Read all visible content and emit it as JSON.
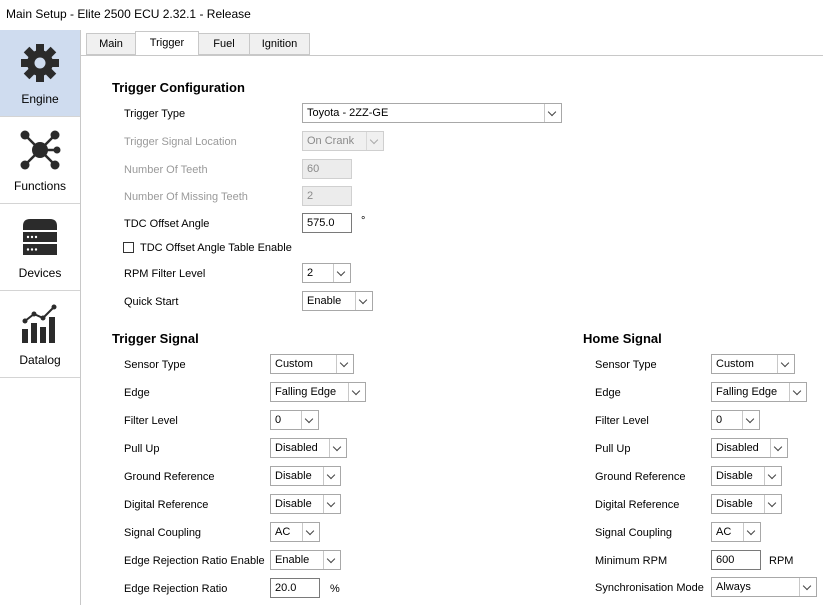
{
  "window": {
    "title": "Main Setup - Elite 2500 ECU 2.32.1 - Release"
  },
  "sidebar": {
    "items": [
      {
        "label": "Engine",
        "icon": "gear-icon",
        "active": true
      },
      {
        "label": "Functions",
        "icon": "network-icon"
      },
      {
        "label": "Devices",
        "icon": "server-icon"
      },
      {
        "label": "Datalog",
        "icon": "chart-icon"
      }
    ]
  },
  "tabs": [
    "Main",
    "Trigger",
    "Fuel",
    "Ignition"
  ],
  "trigger_config": {
    "heading": "Trigger Configuration",
    "trigger_type": {
      "label": "Trigger Type",
      "value": "Toyota - 2ZZ-GE"
    },
    "signal_location": {
      "label": "Trigger Signal Location",
      "value": "On Crank"
    },
    "num_teeth": {
      "label": "Number Of Teeth",
      "value": "60"
    },
    "missing_teeth": {
      "label": "Number Of Missing Teeth",
      "value": "2"
    },
    "tdc_offset": {
      "label": "TDC Offset Angle",
      "value": "575.0",
      "unit": "°"
    },
    "tdc_table_enable": {
      "label": "TDC Offset Angle Table Enable",
      "checked": false
    },
    "rpm_filter": {
      "label": "RPM Filter Level",
      "value": "2"
    },
    "quick_start": {
      "label": "Quick Start",
      "value": "Enable"
    }
  },
  "trigger_signal": {
    "heading": "Trigger Signal",
    "sensor_type": {
      "label": "Sensor Type",
      "value": "Custom"
    },
    "edge": {
      "label": "Edge",
      "value": "Falling Edge"
    },
    "filter_level": {
      "label": "Filter Level",
      "value": "0"
    },
    "pull_up": {
      "label": "Pull Up",
      "value": "Disabled"
    },
    "ground_ref": {
      "label": "Ground Reference",
      "value": "Disable"
    },
    "digital_ref": {
      "label": "Digital Reference",
      "value": "Disable"
    },
    "coupling": {
      "label": "Signal Coupling",
      "value": "AC"
    },
    "edge_reject_enable": {
      "label": "Edge Rejection Ratio Enable",
      "value": "Enable"
    },
    "edge_reject_ratio": {
      "label": "Edge Rejection Ratio",
      "value": "20.0",
      "unit": "%"
    }
  },
  "home_signal": {
    "heading": "Home Signal",
    "sensor_type": {
      "label": "Sensor Type",
      "value": "Custom"
    },
    "edge": {
      "label": "Edge",
      "value": "Falling Edge"
    },
    "filter_level": {
      "label": "Filter Level",
      "value": "0"
    },
    "pull_up": {
      "label": "Pull Up",
      "value": "Disabled"
    },
    "ground_ref": {
      "label": "Ground Reference",
      "value": "Disable"
    },
    "digital_ref": {
      "label": "Digital Reference",
      "value": "Disable"
    },
    "coupling": {
      "label": "Signal Coupling",
      "value": "AC"
    },
    "min_rpm": {
      "label": "Minimum RPM",
      "value": "600",
      "unit": "RPM"
    },
    "sync_mode": {
      "label": "Synchronisation Mode",
      "value": "Always"
    }
  },
  "colors": {
    "sidebar_active": "#cfdcef",
    "icon": "#2b2b2b"
  }
}
